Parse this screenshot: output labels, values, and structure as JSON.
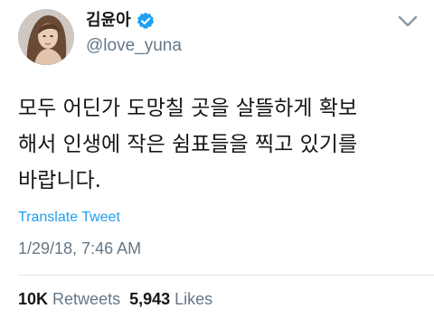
{
  "user": {
    "display_name": "김윤아",
    "handle": "@love_yuna",
    "verified_icon": "verified-badge-icon",
    "avatar_icon": "profile-photo"
  },
  "tweet": {
    "lines": [
      "모두 어딘가 도망칠 곳을 살뜰하게 확보",
      "해서 인생에 작은 쉼표들을 찍고 있기를",
      "바랍니다."
    ],
    "translate_label": "Translate Tweet",
    "timestamp": "1/29/18, 7:46 AM"
  },
  "stats": {
    "retweets_count": "10K",
    "retweets_label": "Retweets",
    "likes_count": "5,943",
    "likes_label": "Likes"
  },
  "icons": {
    "menu": "chevron-down-icon"
  },
  "colors": {
    "accent": "#1da1f2",
    "secondary_text": "#657786",
    "primary_text": "#14171a",
    "divider": "#e1e8ed"
  }
}
